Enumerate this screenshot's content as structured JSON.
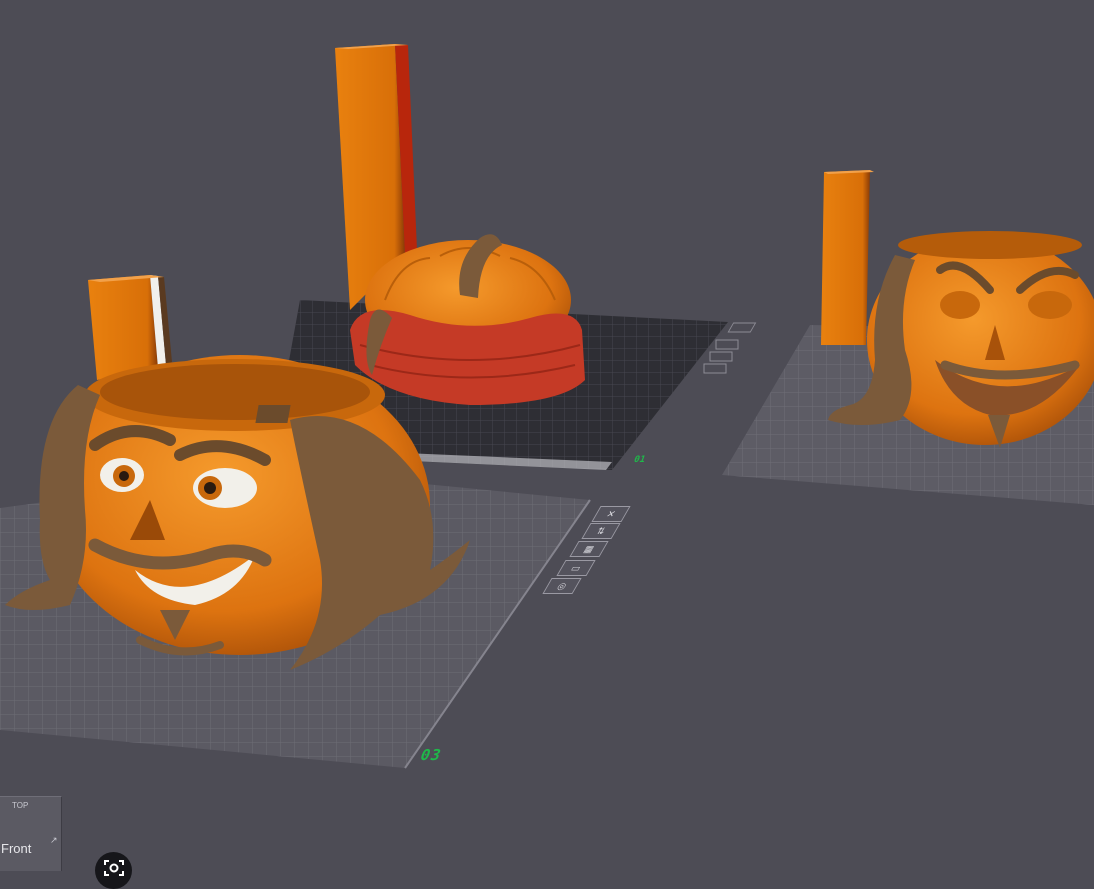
{
  "viewport": {
    "background": "#4d4c55",
    "plates": [
      {
        "id": "plate-01",
        "label": "01"
      },
      {
        "id": "plate-03",
        "label": "03"
      },
      {
        "id": "plate-right",
        "label": ""
      }
    ],
    "plate_tools": [
      {
        "name": "delete-plate-icon",
        "glyph": "✕"
      },
      {
        "name": "arrange-plate-icon",
        "glyph": "⇅"
      },
      {
        "name": "orient-plate-icon",
        "glyph": "▦"
      },
      {
        "name": "lock-plate-icon",
        "glyph": "▭"
      },
      {
        "name": "plate-settings-icon",
        "glyph": "◎"
      }
    ],
    "colors": {
      "pumpkin_orange": "#e07a12",
      "hair_brown": "#7b5a3a",
      "bandana_red": "#c53a26",
      "label_green": "#1fb84a"
    }
  },
  "view_cube": {
    "top_label": "TOP",
    "front_label": "Front",
    "side_glyph": "↗"
  },
  "fit_view": {
    "icon": "camera-fit-icon"
  }
}
